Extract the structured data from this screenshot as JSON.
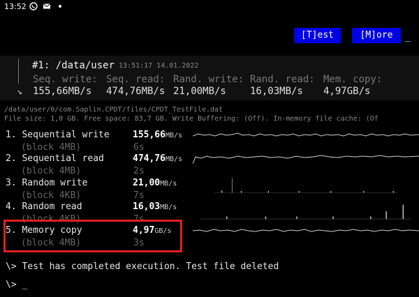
{
  "status_bar": {
    "time": "13:52",
    "icons": [
      "whatsapp-icon",
      "mail-icon",
      "dot-icon"
    ]
  },
  "toolbar": {
    "test_label": "[T]est",
    "more_label": "[M]ore",
    "cursor": "_"
  },
  "result": {
    "title": "#1: /data/user",
    "timestamp": "13:51:17 14.01.2022",
    "headers": [
      "Seq. write:",
      "Seq. read:",
      "Rand. write:",
      "Rand. read:",
      "Mem. copy:"
    ],
    "values": [
      "155,66MB/s",
      "474,76MB/s",
      "21,00MB/s",
      "16,03MB/s",
      "4,97GB/s"
    ],
    "arrow": "↘"
  },
  "file": {
    "path": "/data/user/0/com.Saplin.CPDT/files/CPDT_TestFile.dat",
    "info": "File size: 1,0 GB. Free space: 83,7 GB. Write Buffering: (Off). In-memory file cache: (Of"
  },
  "tests": [
    {
      "name": "1. Sequential write",
      "block": "(block 4MB)",
      "value": "155,66",
      "unit": "MB/s",
      "time": "6s"
    },
    {
      "name": "2. Sequential read",
      "block": "(block 4MB)",
      "value": "474,76",
      "unit": "MB/s",
      "time": "2s"
    },
    {
      "name": "3. Random write",
      "block": "(block 4KB)",
      "value": "21,00",
      "unit": "MB/s",
      "time": "7s"
    },
    {
      "name": "4. Random read",
      "block": "(block 4KB)",
      "value": "16,03",
      "unit": "MB/s",
      "time": "7s"
    },
    {
      "name": "5. Memory copy",
      "block": "(block 4MB)",
      "value": "4,97",
      "unit": "GB/s",
      "time": "3s"
    }
  ],
  "log": "\\> Test has completed execution. Test file deleted",
  "prompt": "\\> _",
  "colors": {
    "button_bg": "#0000e6",
    "highlight": "#e02020",
    "background": "#000000"
  }
}
